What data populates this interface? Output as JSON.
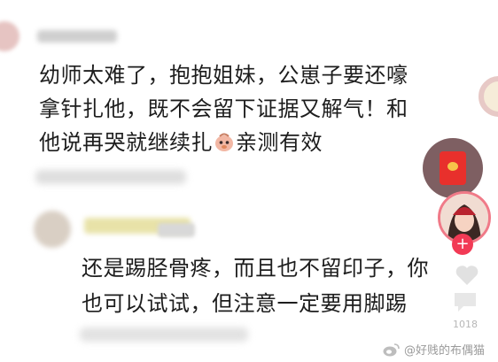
{
  "comment": {
    "lines": [
      "幼师太难了，抱抱姐妹，公崽子要还嚎",
      "拿针扎他，既不会留下证据又解气！和",
      "他说再哭就继续扎",
      "亲测有效"
    ],
    "emoji_icon": "chick-face-icon"
  },
  "reply": {
    "lines": [
      "还是踢胫骨疼，而且也不留印子，你",
      "也可以试试，但注意一定要用脚踢"
    ]
  },
  "sidebar": {
    "follow_label": "+",
    "like_count": "1018"
  },
  "watermark": {
    "text": "@好贱的布偶猫",
    "icon": "weibo-logo-icon"
  },
  "colors": {
    "text": "#1d1d1d",
    "follow": "#f23a55",
    "redpacket": "#e8302c",
    "watermark": "#9a9a9a"
  }
}
